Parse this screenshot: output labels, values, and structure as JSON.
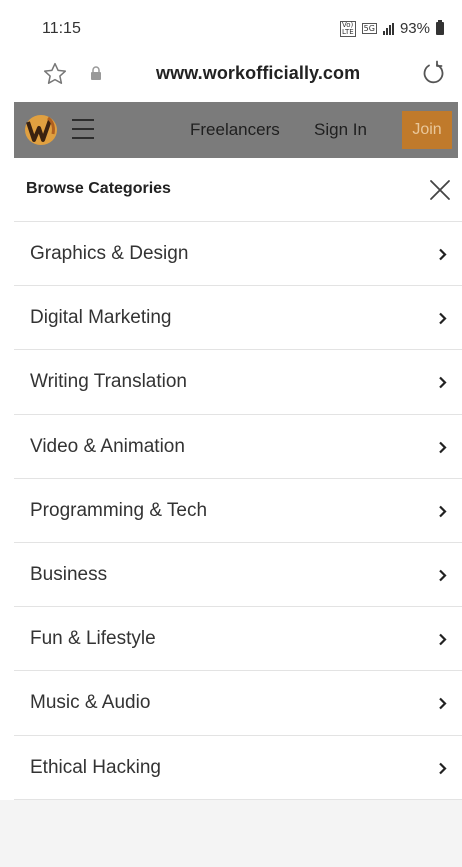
{
  "status_bar": {
    "time": "11:15",
    "network_vo": "Vo)",
    "network_lte": "LTE",
    "network_5g": "5G",
    "battery": "93%"
  },
  "browser": {
    "url": "www.workofficially.com",
    "icons": [
      "star-icon",
      "lock-icon",
      "reload-icon"
    ]
  },
  "site_header": {
    "logo": "logo-icon",
    "nav": {
      "freelancers": "Freelancers",
      "sign_in": "Sign In",
      "join": "Join"
    },
    "colors": {
      "header_bg": "#7b7b7b",
      "join_bg": "#c07a2b",
      "join_text": "#e9c79a"
    }
  },
  "panel": {
    "title": "Browse Categories",
    "categories": [
      {
        "label": "Graphics & Design"
      },
      {
        "label": "Digital Marketing"
      },
      {
        "label": "Writing Translation"
      },
      {
        "label": "Video & Animation"
      },
      {
        "label": "Programming & Tech"
      },
      {
        "label": "Business"
      },
      {
        "label": "Fun & Lifestyle"
      },
      {
        "label": "Music & Audio"
      },
      {
        "label": "Ethical Hacking"
      }
    ]
  }
}
